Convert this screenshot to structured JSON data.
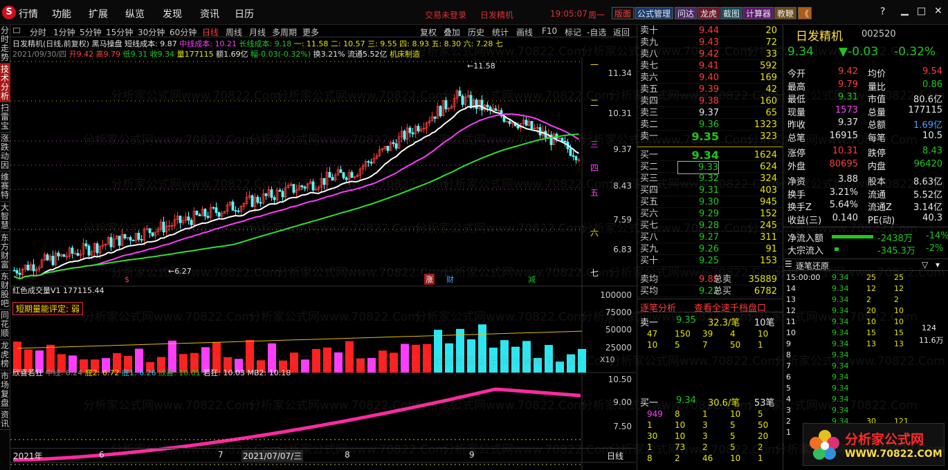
{
  "menu": {
    "items": [
      "行情",
      "功能",
      "扩展",
      "纵览",
      "发现",
      "资讯",
      "日历"
    ],
    "status1": "交易未登录",
    "status2": "日发精机",
    "clock": "19:05:07",
    "weekday": "周一",
    "tools": [
      "版面",
      "公式管理",
      "问达",
      "龙虎",
      "截图",
      "计算器",
      "教鞭",
      "《"
    ]
  },
  "leftnav": [
    "分时走势",
    "技术分析",
    "扫雷宝",
    "涨跌动因",
    "维赛特",
    "大智慧",
    "东方财富",
    "东财股吧",
    "同花顺",
    "龙虎榜",
    "市场复盘",
    "资讯"
  ],
  "periods": [
    "分时",
    "1分钟",
    "5分钟",
    "15分钟",
    "30分钟",
    "60分钟",
    "日线",
    "周线",
    "月线",
    "多周期",
    "更多"
  ],
  "chart_tools": [
    "复权",
    "叠加",
    "历史",
    "统计",
    "画线",
    "F10",
    "标记",
    "-自选",
    "返回"
  ],
  "kline": {
    "title": "日发精机(日线,前复权)",
    "indicator": "黑马操盘",
    "short": "短线成本: 9.87",
    "mid": "中线成本: 10.21",
    "long": "长线成本: 9.18",
    "levels": "一: 11.58  二: 10.57  三: 9.55  四: 8.93  五: 8.30  六: 7.28  七",
    "date": "2021/09/30/四",
    "open": "开9.42",
    "high": "高9.79",
    "low": "低9.31",
    "close": "收9.34",
    "vol": "量177115",
    "amt": "额1.69亿",
    "chg": "幅-0.03(-0.32%)",
    "turn": "换3.21%",
    "float": "流通5.52亿",
    "sector": "机床制造",
    "yaxis": [
      "11.34",
      "10.31",
      "9.37",
      "8.43",
      "7.59",
      "6.83"
    ],
    "hi_mark": "11.58",
    "lo_mark": "6.27",
    "right_marks": [
      "一",
      "二",
      "三",
      "四",
      "五",
      "六",
      "七"
    ],
    "markers": [
      "$",
      "涨",
      "财",
      "减"
    ]
  },
  "volume": {
    "title": "红色成交量V1",
    "value": "177115.44",
    "tag": "短期量能评定: 弱",
    "yaxis": [
      "100000",
      "75000",
      "50000",
      "25000"
    ],
    "unit": "X10"
  },
  "osc": {
    "title": "欣喜若狂",
    "mid": "中线: 8.24",
    "d2": "底2: 6.72",
    "d1": "底1: 6.26",
    "xx": "欣喜: 10.01",
    "rk": "若狂: 10.03",
    "mb": "MB2: 10.18",
    "yaxis": [
      "10.50",
      "9.00",
      "7.50"
    ]
  },
  "xaxis": {
    "labels": [
      "2021年",
      "6",
      "7",
      "2021/07/07/三",
      "8",
      "9"
    ],
    "period": "日线"
  },
  "orderbook": {
    "asks": [
      {
        "l": "卖十",
        "p": "9.44",
        "v": "20"
      },
      {
        "l": "卖九",
        "p": "9.43",
        "v": "72"
      },
      {
        "l": "卖八",
        "p": "9.42",
        "v": "33"
      },
      {
        "l": "卖七",
        "p": "9.41",
        "v": "592"
      },
      {
        "l": "卖六",
        "p": "9.40",
        "v": "169"
      },
      {
        "l": "卖五",
        "p": "9.39",
        "v": "42"
      },
      {
        "l": "卖四",
        "p": "9.38",
        "v": "160"
      },
      {
        "l": "卖三",
        "p": "9.37",
        "v": "65"
      },
      {
        "l": "卖二",
        "p": "9.36",
        "v": "1323"
      },
      {
        "l": "卖一",
        "p": "9.35",
        "v": "323"
      }
    ],
    "bids": [
      {
        "l": "买一",
        "p": "9.34",
        "v": "1624"
      },
      {
        "l": "买二",
        "p": "9.33",
        "v": "624"
      },
      {
        "l": "买三",
        "p": "9.32",
        "v": "324"
      },
      {
        "l": "买四",
        "p": "9.31",
        "v": "403"
      },
      {
        "l": "买五",
        "p": "9.30",
        "v": "945"
      },
      {
        "l": "买六",
        "p": "9.29",
        "v": "152"
      },
      {
        "l": "买七",
        "p": "9.28",
        "v": "245"
      },
      {
        "l": "买八",
        "p": "9.27",
        "v": "311"
      },
      {
        "l": "买九",
        "p": "9.26",
        "v": "91"
      },
      {
        "l": "买十",
        "p": "9.25",
        "v": "153"
      }
    ],
    "avg_sell": "卖均",
    "avg_sell_p": "9.89",
    "tot_sell": "总卖",
    "tot_sell_v": "35889",
    "avg_buy": "买均",
    "avg_buy_p": "9.22",
    "tot_buy": "总买",
    "tot_buy_v": "6782",
    "tab1": "逐笔分析",
    "tab2": "查看全速千档盘口",
    "sell1": {
      "l": "卖一",
      "p": "9.35",
      "q": "32.3/笔",
      "n": "10笔",
      "orders": [
        "47",
        "150",
        "39",
        "4",
        "10",
        "10",
        "5",
        "7",
        "50",
        "1"
      ]
    },
    "buy1": {
      "l": "买一",
      "p": "9.34",
      "q": "30.6/笔",
      "n": "53笔",
      "orders": [
        "949",
        "8",
        "1",
        "10",
        "5",
        "1",
        "10",
        "3",
        "5",
        "50",
        "30",
        "10",
        "3",
        "5",
        "20",
        "1",
        "73",
        "2",
        "5",
        "2",
        "8",
        "2",
        "46",
        "10",
        "1"
      ]
    }
  },
  "stock": {
    "name": "日发精机",
    "code": "002520",
    "price": "9.34",
    "change": "▼-0.03",
    "pct": "-0.32%",
    "fund": [
      [
        "今开",
        "9.42",
        "均价",
        "9.54"
      ],
      [
        "最高",
        "9.79",
        "量比",
        "0.86"
      ],
      [
        "最低",
        "9.31",
        "市值",
        "80.6亿"
      ],
      [
        "现量",
        "1573",
        "总量",
        "177115"
      ],
      [
        "昨收",
        "9.37",
        "总额",
        "1.69亿"
      ],
      [
        "总笔",
        "16915",
        "每笔",
        "10.5"
      ],
      [
        "涨停",
        "10.31",
        "跌停",
        "8.43"
      ],
      [
        "外盘",
        "80695",
        "内盘",
        "96420"
      ],
      [
        "净资",
        "3.88",
        "股本",
        "8.63亿"
      ],
      [
        "换手",
        "3.21%",
        "流通",
        "5.52亿"
      ],
      [
        "换手Z",
        "5.64%",
        "流通Z",
        "3.14亿"
      ],
      [
        "收益(三)",
        "0.140",
        "PE(动)",
        "40.3"
      ]
    ],
    "inflow": "净流入额",
    "inflow_v": "-2438万",
    "inflow_p": "-14%",
    "big": "大宗流入",
    "big_v": "-345.3万",
    "big_p": "-2%",
    "ticks_title": "逐笔还原",
    "ticks": [
      [
        "15:00:00",
        "9.34",
        "25",
        "25"
      ],
      [
        "14",
        "9.34",
        "12",
        "12"
      ],
      [
        "13",
        "9.34",
        "2",
        "2"
      ],
      [
        "12",
        "9.34",
        "20",
        "10"
      ],
      [
        "11",
        "9.34",
        "10",
        "10"
      ],
      [
        "10",
        "9.34",
        "15",
        "15"
      ],
      [
        "9",
        "9.34",
        "13",
        "13"
      ],
      [
        "8",
        "9.34",
        "",
        ""
      ],
      [
        "7",
        "9.34",
        "",
        ""
      ],
      [
        "6",
        "9.34",
        "",
        ""
      ],
      [
        "5",
        "9.34",
        "",
        ""
      ],
      [
        "4",
        "9.34",
        "",
        ""
      ],
      [
        "3",
        "9.34",
        "",
        ""
      ],
      [
        "2",
        "9.34",
        "30",
        "121"
      ],
      [
        "1",
        "9.34",
        "",
        ""
      ]
    ],
    "tick_right": "124",
    "tick_right2": "11.6万"
  },
  "ad": {
    "name": "分析家公式网",
    "url": "WWW.70822.COM"
  },
  "watermark": "分析家公式网www.70822.Com"
}
